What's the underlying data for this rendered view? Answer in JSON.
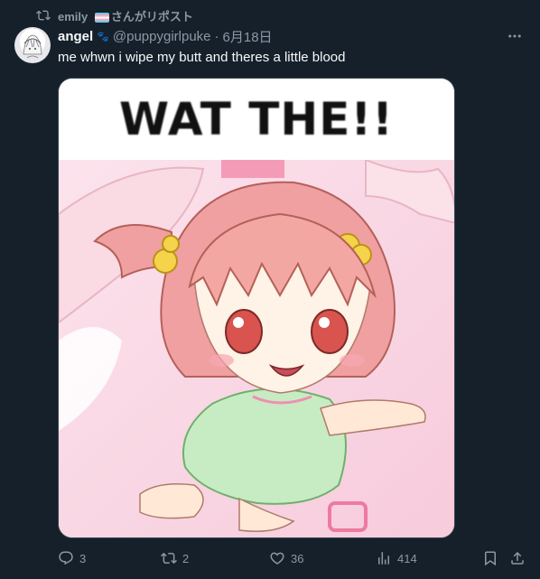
{
  "repost": {
    "user": "emily",
    "suffix": "さんがリポスト"
  },
  "author": {
    "display_name": "angel",
    "badge": "🐾",
    "handle": "@puppygirlpuke",
    "separator": "·",
    "date": "6月18日"
  },
  "tweet": {
    "text": "me whwn i wipe my butt and theres a little blood"
  },
  "media": {
    "caption": "WAT THE!!"
  },
  "actions": {
    "replies": "3",
    "reposts": "2",
    "likes": "36",
    "views": "414"
  },
  "colors": {
    "background": "#15202b",
    "text": "#f7f9f9",
    "secondary": "#8b98a5"
  }
}
